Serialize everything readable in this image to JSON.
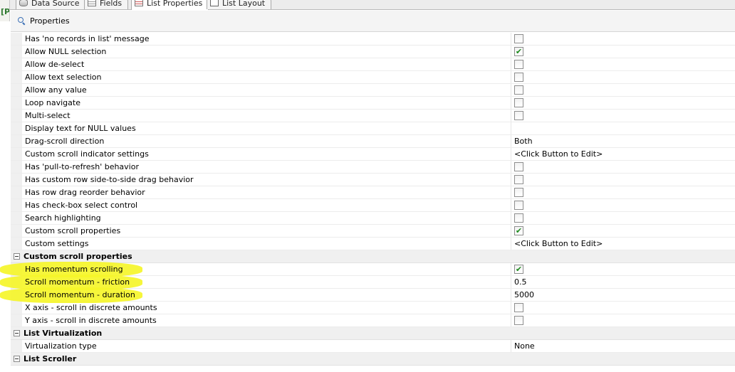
{
  "tabs": [
    {
      "label": "Data Source",
      "icon": "database-icon",
      "active": false
    },
    {
      "label": "Fields",
      "icon": "fields-icon",
      "active": false
    },
    {
      "label": "List Properties",
      "icon": "list-properties-icon",
      "active": true
    },
    {
      "label": "List Layout",
      "icon": "list-layout-icon",
      "active": false
    }
  ],
  "left_strip_text": "[P",
  "properties_header": {
    "label": "Properties",
    "icon": "properties-search-icon"
  },
  "rows": [
    {
      "kind": "prop",
      "name": "Has 'no records in list' message",
      "type": "checkbox",
      "checked": false
    },
    {
      "kind": "prop",
      "name": "Allow NULL selection",
      "type": "checkbox",
      "checked": true
    },
    {
      "kind": "prop",
      "name": "Allow de-select",
      "type": "checkbox",
      "checked": false
    },
    {
      "kind": "prop",
      "name": "Allow text selection",
      "type": "checkbox",
      "checked": false
    },
    {
      "kind": "prop",
      "name": "Allow any value",
      "type": "checkbox",
      "checked": false
    },
    {
      "kind": "prop",
      "name": "Loop navigate",
      "type": "checkbox",
      "checked": false
    },
    {
      "kind": "prop",
      "name": "Multi-select",
      "type": "checkbox",
      "checked": false
    },
    {
      "kind": "prop",
      "name": "Display text for NULL values",
      "type": "text",
      "value": ""
    },
    {
      "kind": "prop",
      "name": "Drag-scroll direction",
      "type": "text",
      "value": "Both"
    },
    {
      "kind": "prop",
      "name": "Custom scroll indicator settings",
      "type": "text",
      "value": "<Click Button to Edit>"
    },
    {
      "kind": "prop",
      "name": "Has 'pull-to-refresh' behavior",
      "type": "checkbox",
      "checked": false
    },
    {
      "kind": "prop",
      "name": "Has custom row side-to-side drag behavior",
      "type": "checkbox",
      "checked": false
    },
    {
      "kind": "prop",
      "name": "Has row drag reorder behavior",
      "type": "checkbox",
      "checked": false
    },
    {
      "kind": "prop",
      "name": "Has check-box select control",
      "type": "checkbox",
      "checked": false
    },
    {
      "kind": "prop",
      "name": "Search highlighting",
      "type": "checkbox",
      "checked": false
    },
    {
      "kind": "prop",
      "name": "Custom scroll properties",
      "type": "checkbox",
      "checked": true
    },
    {
      "kind": "prop",
      "name": "Custom settings",
      "type": "text",
      "value": "<Click Button to Edit>"
    },
    {
      "kind": "section",
      "name": "Custom scroll properties"
    },
    {
      "kind": "prop",
      "name": "Has momentum scrolling",
      "type": "checkbox",
      "checked": true,
      "highlight": true
    },
    {
      "kind": "prop",
      "name": "Scroll momentum - friction",
      "type": "text",
      "value": "0.5",
      "highlight": true
    },
    {
      "kind": "prop",
      "name": "Scroll momentum - duration",
      "type": "text",
      "value": "5000",
      "highlight": true
    },
    {
      "kind": "prop",
      "name": "X axis - scroll in discrete amounts",
      "type": "checkbox",
      "checked": false
    },
    {
      "kind": "prop",
      "name": "Y axis - scroll in discrete amounts",
      "type": "checkbox",
      "checked": false
    },
    {
      "kind": "section",
      "name": "List Virtualization"
    },
    {
      "kind": "prop",
      "name": "Virtualization type",
      "type": "text",
      "value": "None"
    },
    {
      "kind": "section",
      "name": "List Scroller"
    }
  ],
  "colors": {
    "highlighter": "#f5f52a",
    "check": "#1c8a1c",
    "section_bg": "#f0f0f0"
  }
}
